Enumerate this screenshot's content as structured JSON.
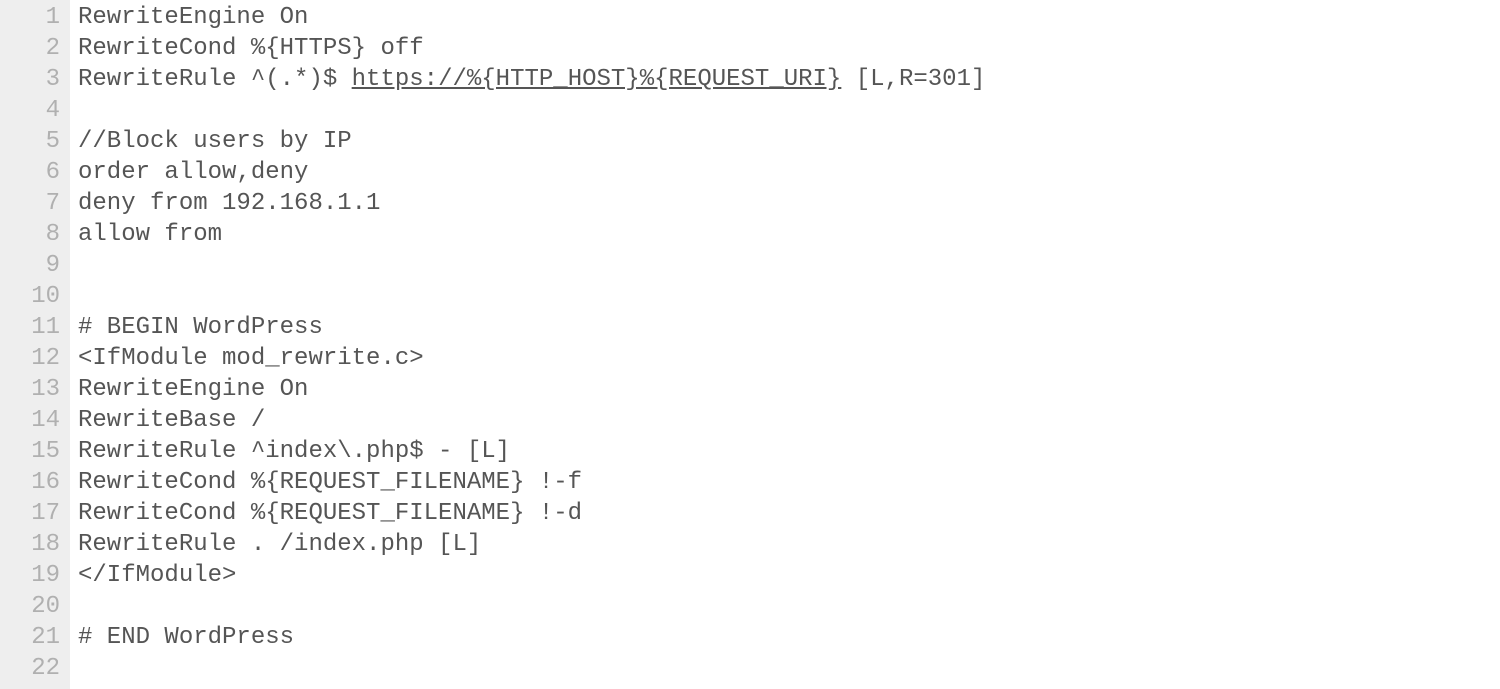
{
  "lines": [
    {
      "n": "1",
      "segments": [
        {
          "t": "RewriteEngine On"
        }
      ]
    },
    {
      "n": "2",
      "segments": [
        {
          "t": "RewriteCond %{HTTPS} off"
        }
      ]
    },
    {
      "n": "3",
      "segments": [
        {
          "t": "RewriteRule ^(.*)$ "
        },
        {
          "t": "https://%{HTTP_HOST}%{REQUEST_URI}",
          "u": true
        },
        {
          "t": " [L,R=301]"
        }
      ]
    },
    {
      "n": "4",
      "segments": [
        {
          "t": ""
        }
      ]
    },
    {
      "n": "5",
      "segments": [
        {
          "t": "//Block users by IP"
        }
      ]
    },
    {
      "n": "6",
      "segments": [
        {
          "t": "order allow,deny"
        }
      ]
    },
    {
      "n": "7",
      "segments": [
        {
          "t": "deny from 192.168.1.1"
        }
      ]
    },
    {
      "n": "8",
      "segments": [
        {
          "t": "allow from"
        }
      ]
    },
    {
      "n": "9",
      "segments": [
        {
          "t": ""
        }
      ]
    },
    {
      "n": "10",
      "segments": [
        {
          "t": ""
        }
      ]
    },
    {
      "n": "11",
      "segments": [
        {
          "t": "# BEGIN WordPress"
        }
      ]
    },
    {
      "n": "12",
      "segments": [
        {
          "t": "<IfModule mod_rewrite.c>"
        }
      ]
    },
    {
      "n": "13",
      "segments": [
        {
          "t": "RewriteEngine On"
        }
      ]
    },
    {
      "n": "14",
      "segments": [
        {
          "t": "RewriteBase /"
        }
      ]
    },
    {
      "n": "15",
      "segments": [
        {
          "t": "RewriteRule ^index\\.php$ - [L]"
        }
      ]
    },
    {
      "n": "16",
      "segments": [
        {
          "t": "RewriteCond %{REQUEST_FILENAME} !-f"
        }
      ]
    },
    {
      "n": "17",
      "segments": [
        {
          "t": "RewriteCond %{REQUEST_FILENAME} !-d"
        }
      ]
    },
    {
      "n": "18",
      "segments": [
        {
          "t": "RewriteRule . /index.php [L]"
        }
      ]
    },
    {
      "n": "19",
      "segments": [
        {
          "t": "</IfModule>"
        }
      ]
    },
    {
      "n": "20",
      "segments": [
        {
          "t": ""
        }
      ]
    },
    {
      "n": "21",
      "segments": [
        {
          "t": "# END WordPress"
        }
      ]
    },
    {
      "n": "22",
      "segments": [
        {
          "t": ""
        }
      ]
    }
  ]
}
